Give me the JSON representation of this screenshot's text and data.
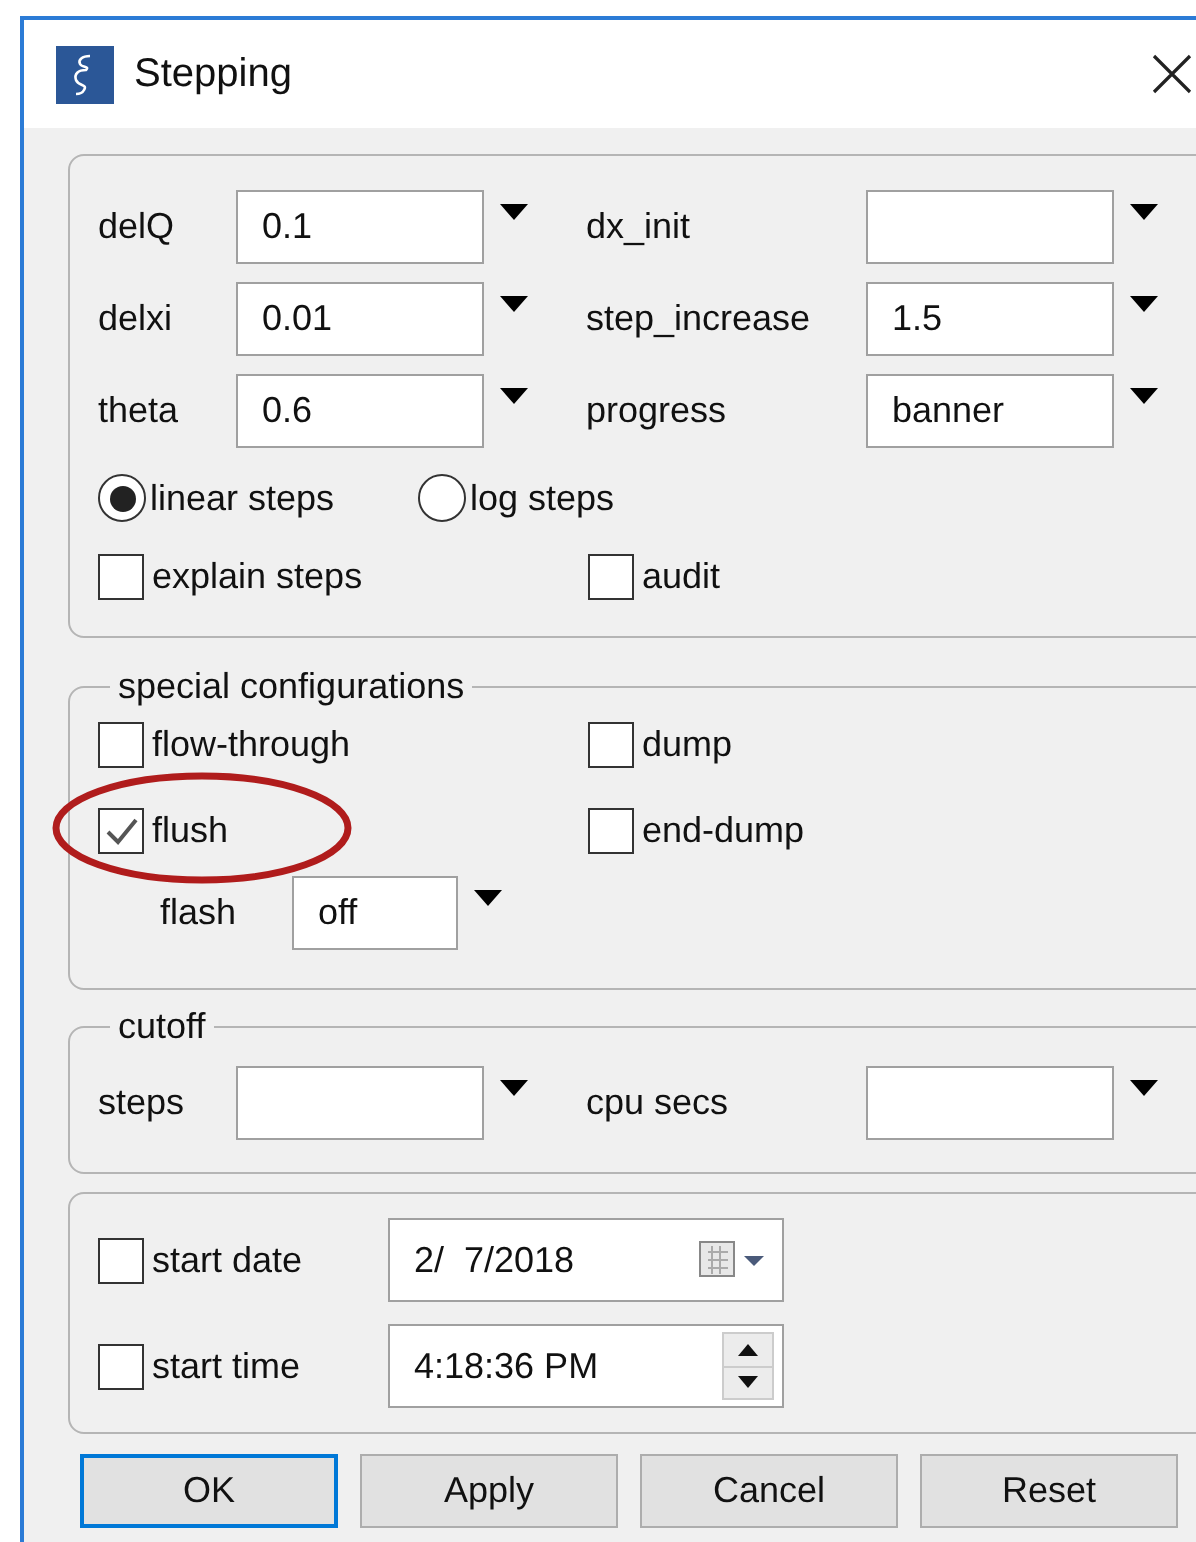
{
  "window": {
    "title": "Stepping"
  },
  "parameters": [
    {
      "label": "delQ",
      "value": "0.1"
    },
    {
      "label": "dx_init"
    },
    {
      "label": "delxi",
      "value": "0.01"
    },
    {
      "label": "step_increase",
      "value": "1.5"
    },
    {
      "label": "theta",
      "value": "0.6"
    },
    {
      "label": "progress",
      "value": "banner"
    }
  ],
  "step_mode": [
    {
      "label": "linear steps",
      "selected": true
    },
    {
      "label": "log steps",
      "selected": false
    }
  ],
  "options": [
    {
      "label": "explain steps",
      "checked": false
    },
    {
      "label": "audit",
      "checked": false
    }
  ],
  "special_configurations": {
    "title": "special configurations",
    "options": [
      {
        "label": "flow-through",
        "checked": false,
        "highlighted": false
      },
      {
        "label": "dump",
        "checked": false,
        "highlighted": false
      },
      {
        "label": "flush",
        "checked": true,
        "highlighted": true
      },
      {
        "label": "end-dump",
        "checked": false,
        "highlighted": false
      }
    ],
    "flash": {
      "label": "flash",
      "value": "off"
    }
  },
  "cutoff": {
    "title": "cutoff",
    "fields": [
      {
        "label": "steps"
      },
      {
        "label": "cpu secs"
      }
    ]
  },
  "start": [
    {
      "kind": "date",
      "label": "start date",
      "checked": false,
      "value": "2/  7/2018"
    },
    {
      "kind": "time",
      "label": "start time",
      "checked": false,
      "value": "4:18:36 PM"
    }
  ],
  "buttons": [
    {
      "label": "OK",
      "default": true
    },
    {
      "label": "Apply",
      "default": false
    },
    {
      "label": "Cancel",
      "default": false
    },
    {
      "label": "Reset",
      "default": false
    }
  ]
}
